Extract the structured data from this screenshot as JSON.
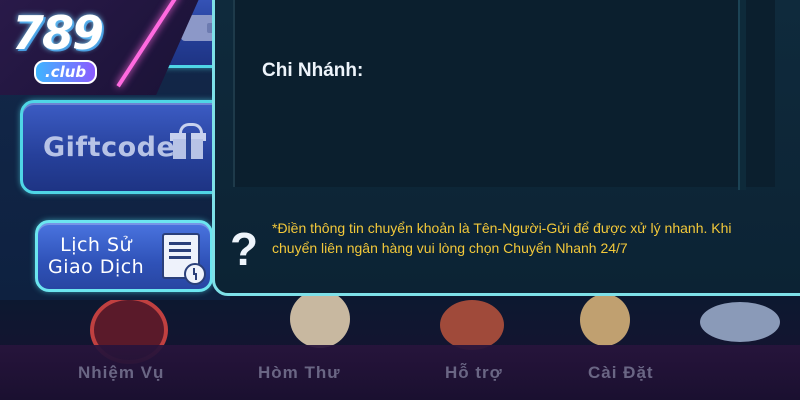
{
  "logo": {
    "number": "789",
    "sub": ".club"
  },
  "side_menu": {
    "gift_label": "Giftcode",
    "history_line1": "Lịch Sử",
    "history_line2": "Giao Dịch"
  },
  "panel": {
    "branch_label": "Chi Nhánh:",
    "help_symbol": "?",
    "note": "*Điền thông tin chuyển khoản là Tên-Người-Gửi để được xử lý nhanh. Khi chuyển liên ngân hàng vui lòng chọn Chuyển Nhanh 24/7"
  },
  "bottom_nav": [
    {
      "label": "Nhiệm Vụ"
    },
    {
      "label": "Hòm Thư"
    },
    {
      "label": "Hỗ trợ"
    },
    {
      "label": "Cài Đặt"
    }
  ],
  "colors": {
    "accent_cyan": "#7ee0e8",
    "button_blue": "#2f52b8",
    "note_yellow": "#f2c83a",
    "logo_magenta": "#ff6ae0"
  }
}
